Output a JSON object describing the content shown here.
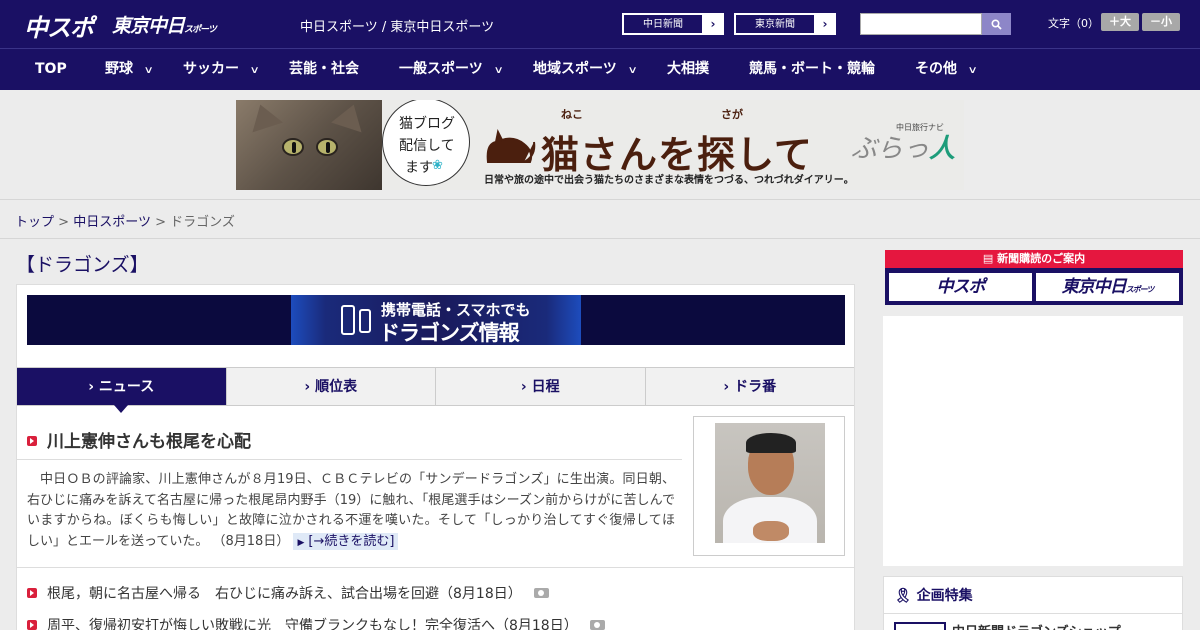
{
  "header": {
    "logo_chuspo": "中スポ",
    "logo_tokyo": "東京中日",
    "logo_tokyo_small": "スポーツ",
    "site_title": "中日スポーツ / 東京中日スポーツ",
    "btn_chunichi": "中日新聞",
    "btn_tokyo": "東京新聞",
    "font_label": "文字（0）",
    "font_larger": "＋大",
    "font_smaller": "－小"
  },
  "nav": {
    "items": [
      {
        "label": "TOP"
      },
      {
        "label": "野球"
      },
      {
        "label": "サッカー"
      },
      {
        "label": "芸能・社会"
      },
      {
        "label": "一般スポーツ"
      },
      {
        "label": "地域スポーツ"
      },
      {
        "label": "大相撲"
      },
      {
        "label": "競馬・ボート・競輪"
      },
      {
        "label": "その他"
      }
    ]
  },
  "banner": {
    "bubble_line1": "猫ブログ",
    "bubble_line2": "配信して",
    "bubble_line3": "ます",
    "title": "猫さんを探して",
    "ruby1": "ねこ",
    "ruby2": "さが",
    "subtitle": "日常や旅の途中で出会う猫たちのさまざまな表情をつづる、つれづれダイアリー。",
    "brand_small": "中日旅行ナビ",
    "brand_a": "ぶらっ",
    "brand_b": "人"
  },
  "breadcrumb": {
    "top": "トップ",
    "sep": ">",
    "parent": "中日スポーツ",
    "current": "ドラゴンズ"
  },
  "page_heading": "【ドラゴンズ】",
  "dragon_banner": {
    "line1": "携帯電話・スマホでも",
    "line2": "ドラゴンズ情報"
  },
  "tabs": [
    {
      "label": "ニュース"
    },
    {
      "label": "順位表"
    },
    {
      "label": "日程"
    },
    {
      "label": "ドラ番"
    }
  ],
  "article": {
    "title": "川上憲伸さんも根尾を心配",
    "body": "中日ＯＢの評論家、川上憲伸さんが８月19日、ＣＢＣテレビの「サンデードラゴンズ」に生出演。同日朝、右ひじに痛みを訴えて名古屋に帰った根尾昂内野手（19）に触れ、「根尾選手はシーズン前からけがに苦しんでいますからね。ぼくらも悔しい」と故障に泣かされる不運を嘆いた。そして「しっかり治してすぐ復帰してほしい」とエールを送っていた。",
    "date": "（8月18日）",
    "read_more": "[→続きを読む]"
  },
  "news_list": [
    {
      "text": "根尾，朝に名古屋へ帰る　右ひじに痛み訴え、試合出場を回避（8月18日）"
    },
    {
      "text": "周平、復帰初安打が悔しい敗戦に光　守備ブランクもなし！完全復活へ（8月18日）"
    }
  ],
  "sidebar": {
    "subscribe_head": "新聞購読のご案内",
    "sub_chuspo": "中スポ",
    "sub_tokyo": "東京中日",
    "sub_tokyo_small": "スポーツ",
    "feature_title": "企画特集",
    "feature_item": "中日新聞ドラゴンズショップ"
  },
  "colors": {
    "brand": "#1a1064",
    "accent_red": "#e5173f",
    "tab_bg": "#f1f1f1"
  }
}
